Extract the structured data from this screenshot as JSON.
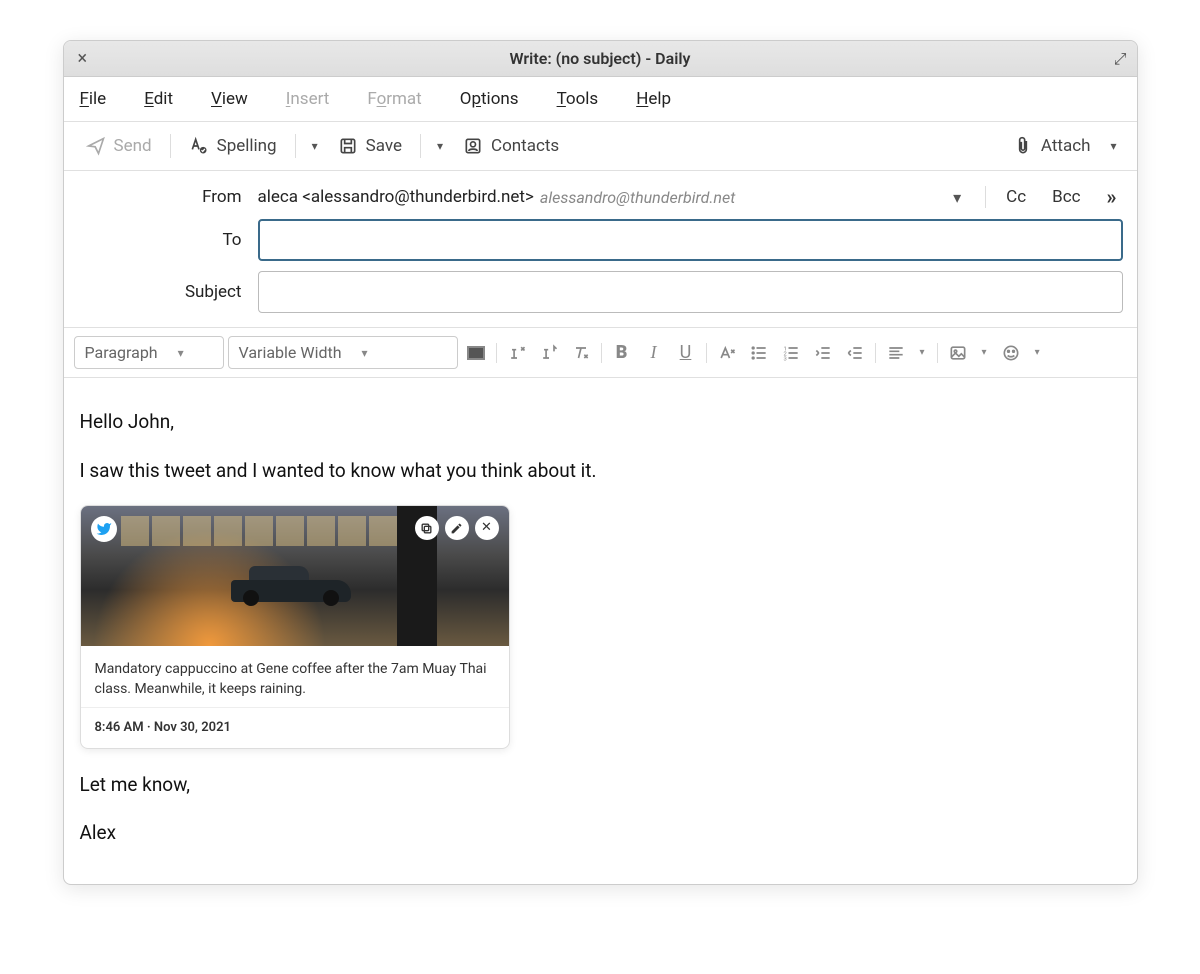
{
  "titlebar": {
    "title": "Write: (no subject) - Daily"
  },
  "menubar": {
    "file": "File",
    "edit": "Edit",
    "view": "View",
    "insert": "Insert",
    "format": "Format",
    "options": "Options",
    "tools": "Tools",
    "help": "Help"
  },
  "toolbar": {
    "send": "Send",
    "spelling": "Spelling",
    "save": "Save",
    "contacts": "Contacts",
    "attach": "Attach"
  },
  "headers": {
    "from_label": "From",
    "from_value": "aleca <alessandro@thunderbird.net>",
    "from_identity": "alessandro@thunderbird.net",
    "cc": "Cc",
    "bcc": "Bcc",
    "to_label": "To",
    "to_value": "",
    "subject_label": "Subject",
    "subject_value": ""
  },
  "format_toolbar": {
    "paragraph": "Paragraph",
    "font": "Variable Width"
  },
  "body": {
    "line1": "Hello John,",
    "line2": "I saw this tweet and I wanted to know what you think about it.",
    "line3": "Let me know,",
    "line4": "Alex"
  },
  "card": {
    "text": "Mandatory cappuccino at Gene coffee after the 7am Muay Thai class. Meanwhile, it keeps raining.",
    "timestamp": "8:46 AM · Nov 30, 2021"
  }
}
